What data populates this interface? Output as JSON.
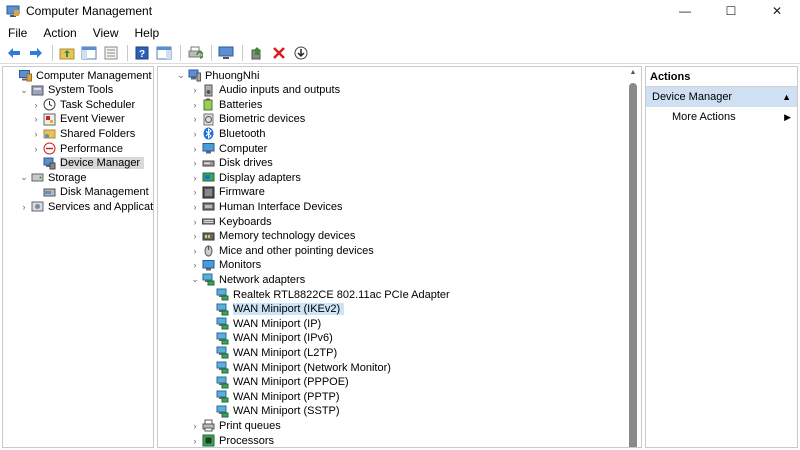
{
  "window": {
    "title": "Computer Management",
    "minimize": "—",
    "maximize": "☐",
    "close": "✕"
  },
  "menu": [
    "File",
    "Action",
    "View",
    "Help"
  ],
  "left_tree": [
    {
      "label": "Computer Management (Local)",
      "indent": 0,
      "arrow": "",
      "icon": "computer-management-icon"
    },
    {
      "label": "System Tools",
      "indent": 1,
      "arrow": "v",
      "icon": "system-tools-icon"
    },
    {
      "label": "Task Scheduler",
      "indent": 2,
      "arrow": ">",
      "icon": "clock-icon"
    },
    {
      "label": "Event Viewer",
      "indent": 2,
      "arrow": ">",
      "icon": "event-viewer-icon"
    },
    {
      "label": "Shared Folders",
      "indent": 2,
      "arrow": ">",
      "icon": "shared-folder-icon"
    },
    {
      "label": "Performance",
      "indent": 2,
      "arrow": ">",
      "icon": "performance-icon"
    },
    {
      "label": "Device Manager",
      "indent": 2,
      "arrow": "",
      "icon": "device-manager-icon",
      "selected": true
    },
    {
      "label": "Storage",
      "indent": 1,
      "arrow": "v",
      "icon": "storage-icon"
    },
    {
      "label": "Disk Management",
      "indent": 2,
      "arrow": "",
      "icon": "disk-management-icon"
    },
    {
      "label": "Services and Applications",
      "indent": 1,
      "arrow": ">",
      "icon": "services-icon"
    }
  ],
  "device_tree": [
    {
      "label": "PhuongNhi",
      "indent": 0,
      "arrow": "v",
      "icon": "computer-icon"
    },
    {
      "label": "Audio inputs and outputs",
      "indent": 1,
      "arrow": ">",
      "icon": "speaker-icon"
    },
    {
      "label": "Batteries",
      "indent": 1,
      "arrow": ">",
      "icon": "battery-icon"
    },
    {
      "label": "Biometric devices",
      "indent": 1,
      "arrow": ">",
      "icon": "biometric-icon"
    },
    {
      "label": "Bluetooth",
      "indent": 1,
      "arrow": ">",
      "icon": "bluetooth-icon"
    },
    {
      "label": "Computer",
      "indent": 1,
      "arrow": ">",
      "icon": "monitor-icon"
    },
    {
      "label": "Disk drives",
      "indent": 1,
      "arrow": ">",
      "icon": "disk-drive-icon"
    },
    {
      "label": "Display adapters",
      "indent": 1,
      "arrow": ">",
      "icon": "display-adapter-icon"
    },
    {
      "label": "Firmware",
      "indent": 1,
      "arrow": ">",
      "icon": "firmware-icon"
    },
    {
      "label": "Human Interface Devices",
      "indent": 1,
      "arrow": ">",
      "icon": "hid-icon"
    },
    {
      "label": "Keyboards",
      "indent": 1,
      "arrow": ">",
      "icon": "keyboard-icon"
    },
    {
      "label": "Memory technology devices",
      "indent": 1,
      "arrow": ">",
      "icon": "memory-icon"
    },
    {
      "label": "Mice and other pointing devices",
      "indent": 1,
      "arrow": ">",
      "icon": "mouse-icon"
    },
    {
      "label": "Monitors",
      "indent": 1,
      "arrow": ">",
      "icon": "monitor-icon"
    },
    {
      "label": "Network adapters",
      "indent": 1,
      "arrow": "v",
      "icon": "network-adapter-icon"
    },
    {
      "label": "Realtek RTL8822CE 802.11ac PCIe Adapter",
      "indent": 2,
      "arrow": "",
      "icon": "network-adapter-icon"
    },
    {
      "label": "WAN Miniport (IKEv2)",
      "indent": 2,
      "arrow": "",
      "icon": "network-adapter-icon",
      "selected": true
    },
    {
      "label": "WAN Miniport (IP)",
      "indent": 2,
      "arrow": "",
      "icon": "network-adapter-icon"
    },
    {
      "label": "WAN Miniport (IPv6)",
      "indent": 2,
      "arrow": "",
      "icon": "network-adapter-icon"
    },
    {
      "label": "WAN Miniport (L2TP)",
      "indent": 2,
      "arrow": "",
      "icon": "network-adapter-icon"
    },
    {
      "label": "WAN Miniport (Network Monitor)",
      "indent": 2,
      "arrow": "",
      "icon": "network-adapter-icon"
    },
    {
      "label": "WAN Miniport (PPPOE)",
      "indent": 2,
      "arrow": "",
      "icon": "network-adapter-icon"
    },
    {
      "label": "WAN Miniport (PPTP)",
      "indent": 2,
      "arrow": "",
      "icon": "network-adapter-icon"
    },
    {
      "label": "WAN Miniport (SSTP)",
      "indent": 2,
      "arrow": "",
      "icon": "network-adapter-icon"
    },
    {
      "label": "Print queues",
      "indent": 1,
      "arrow": ">",
      "icon": "printer-icon"
    },
    {
      "label": "Processors",
      "indent": 1,
      "arrow": ">",
      "icon": "processor-icon"
    }
  ],
  "actions": {
    "header": "Actions",
    "section": "Device Manager",
    "more": "More Actions"
  },
  "colors": {
    "selection_blue": "#cce4f7",
    "selection_grey": "#d9d9d9",
    "actions_band": "#cfe0f3",
    "accent": "#1e6fd9"
  }
}
